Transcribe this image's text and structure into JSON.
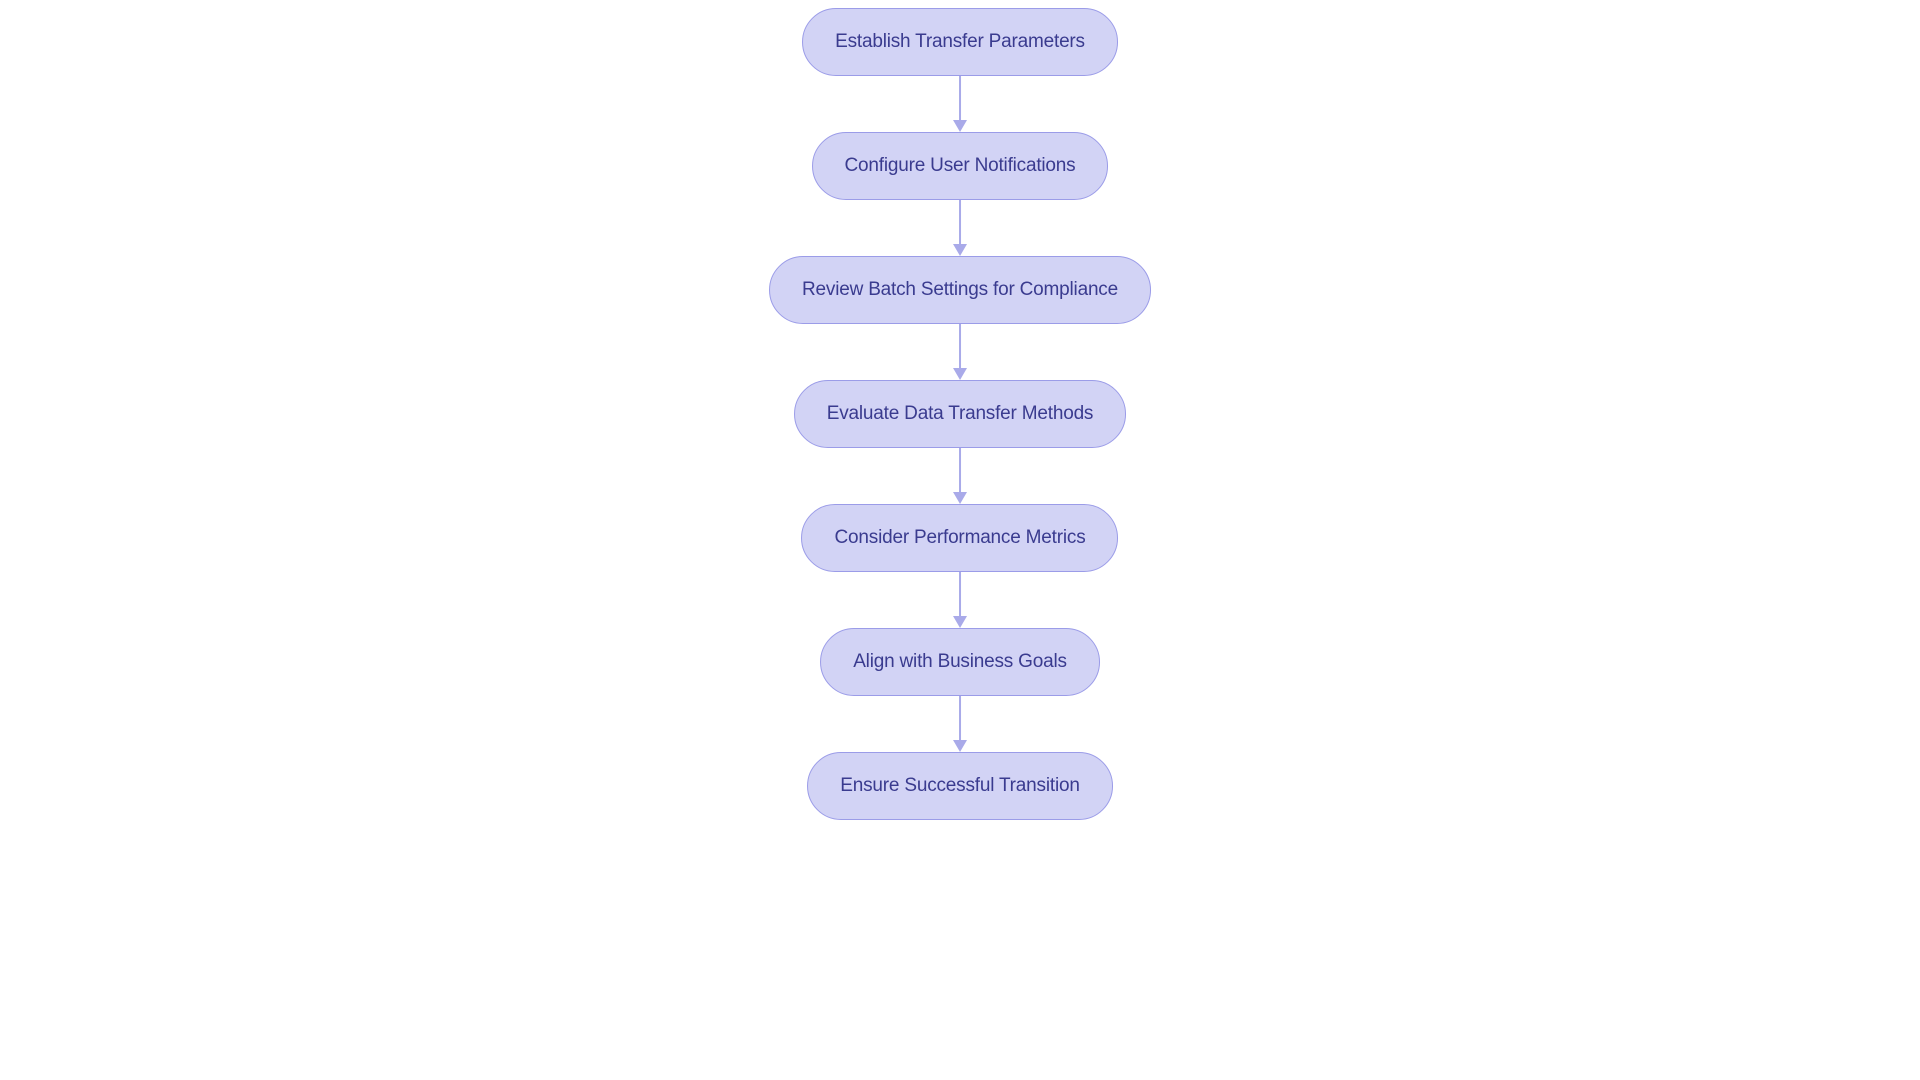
{
  "flowchart": {
    "nodes": [
      {
        "label": "Establish Transfer Parameters"
      },
      {
        "label": "Configure User Notifications"
      },
      {
        "label": "Review Batch Settings for Compliance"
      },
      {
        "label": "Evaluate Data Transfer Methods"
      },
      {
        "label": "Consider Performance Metrics"
      },
      {
        "label": "Align with Business Goals"
      },
      {
        "label": "Ensure Successful Transition"
      }
    ],
    "colors": {
      "node_bg": "#d2d3f5",
      "node_border": "#9b9ce8",
      "node_text": "#3a3b8f",
      "connector": "#a9aae9"
    }
  }
}
